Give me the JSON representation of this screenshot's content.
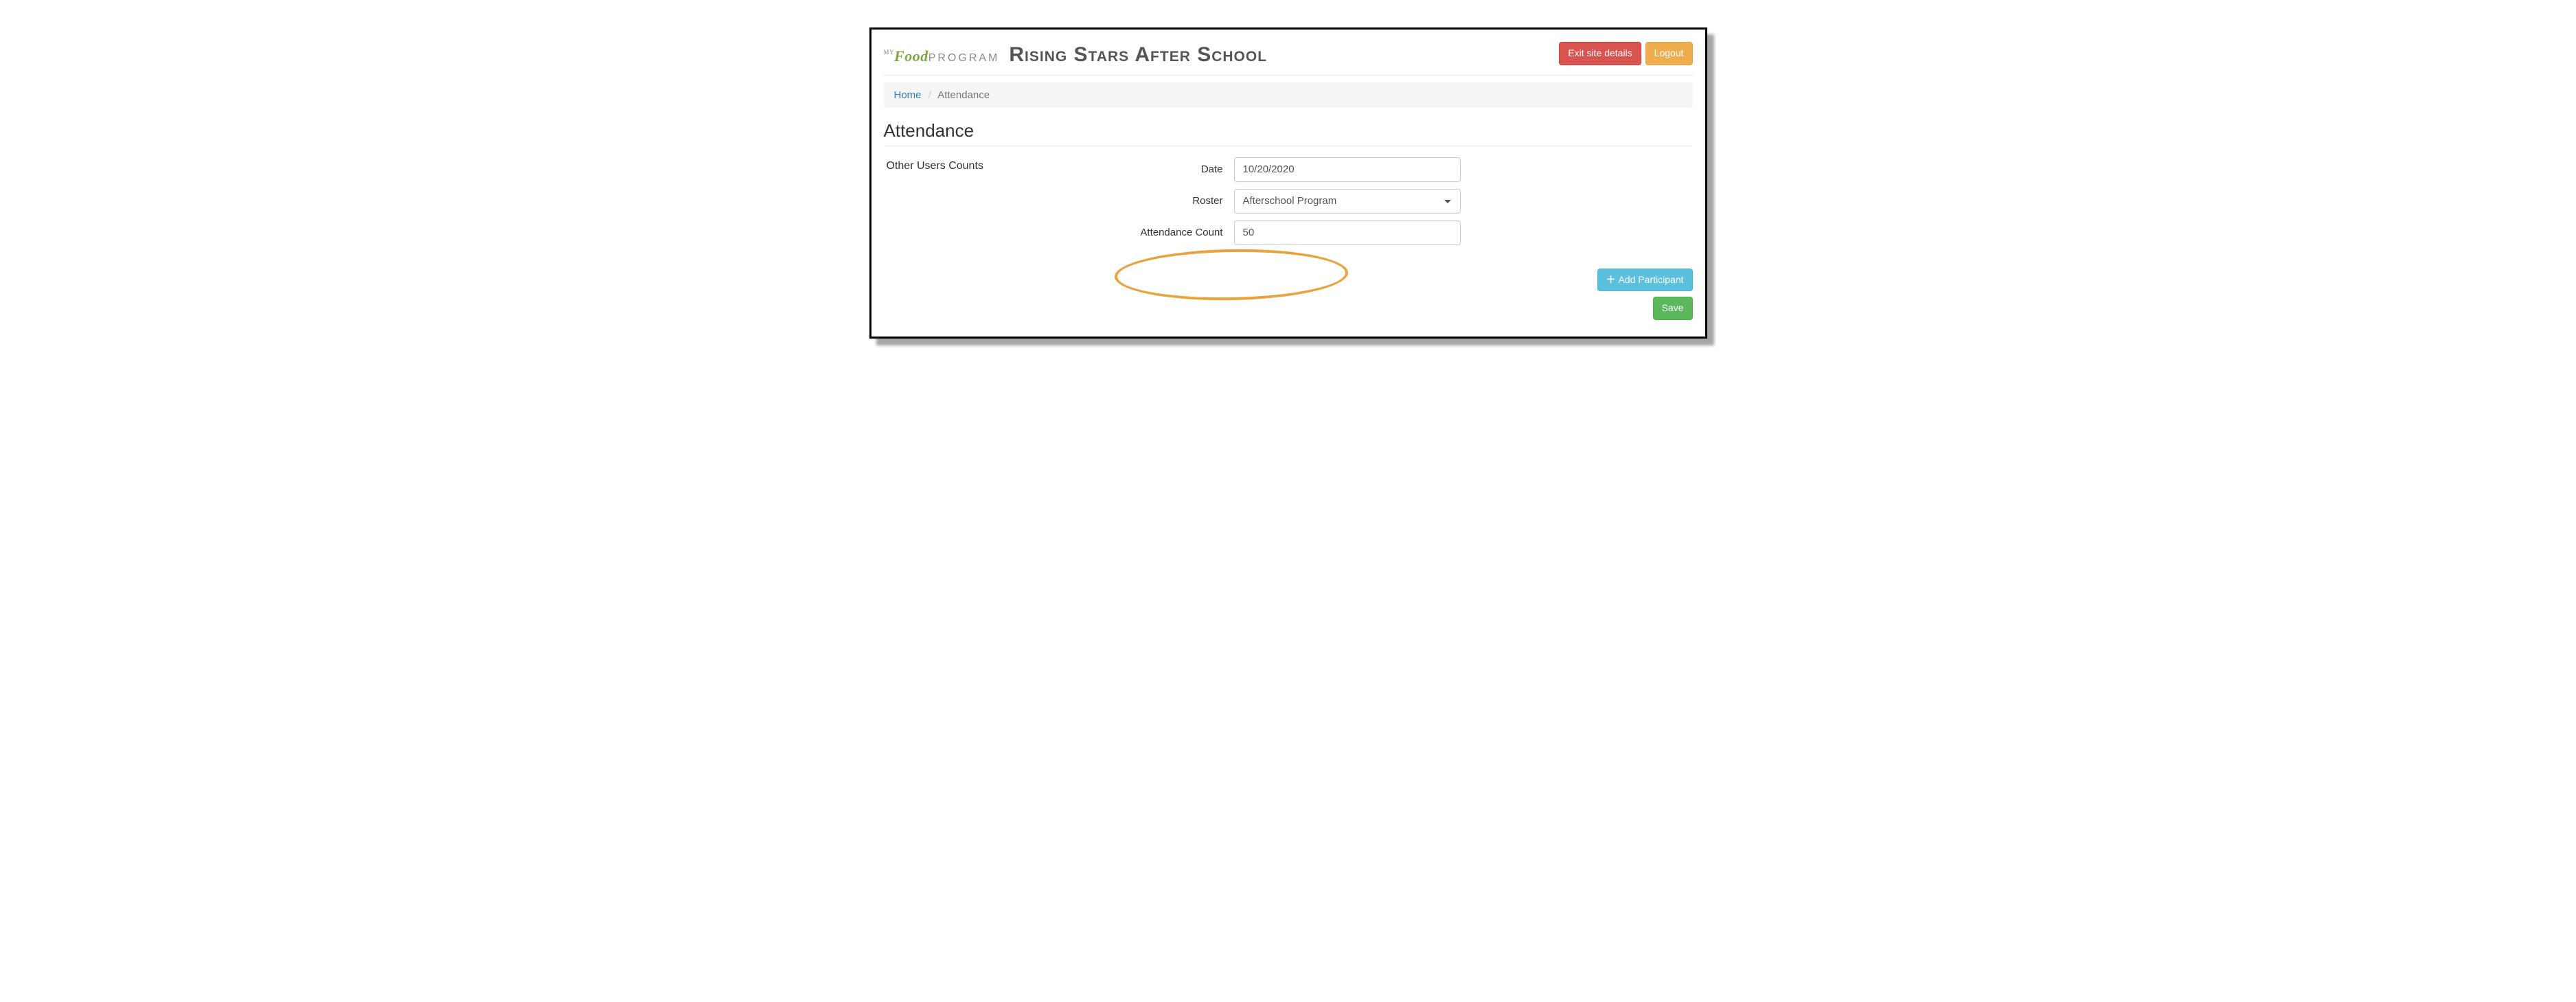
{
  "header": {
    "logo_text": "Food PROGRAM",
    "site_title": "Rising Stars After School",
    "exit_label": "Exit site details",
    "logout_label": "Logout"
  },
  "breadcrumb": {
    "home": "Home",
    "current": "Attendance"
  },
  "page": {
    "heading": "Attendance",
    "section_label": "Other Users Counts"
  },
  "form": {
    "date_label": "Date",
    "date_value": "10/20/2020",
    "roster_label": "Roster",
    "roster_value": "Afterschool Program",
    "count_label": "Attendance Count",
    "count_value": "50"
  },
  "actions": {
    "add_participant": "Add Participant",
    "save": "Save"
  }
}
